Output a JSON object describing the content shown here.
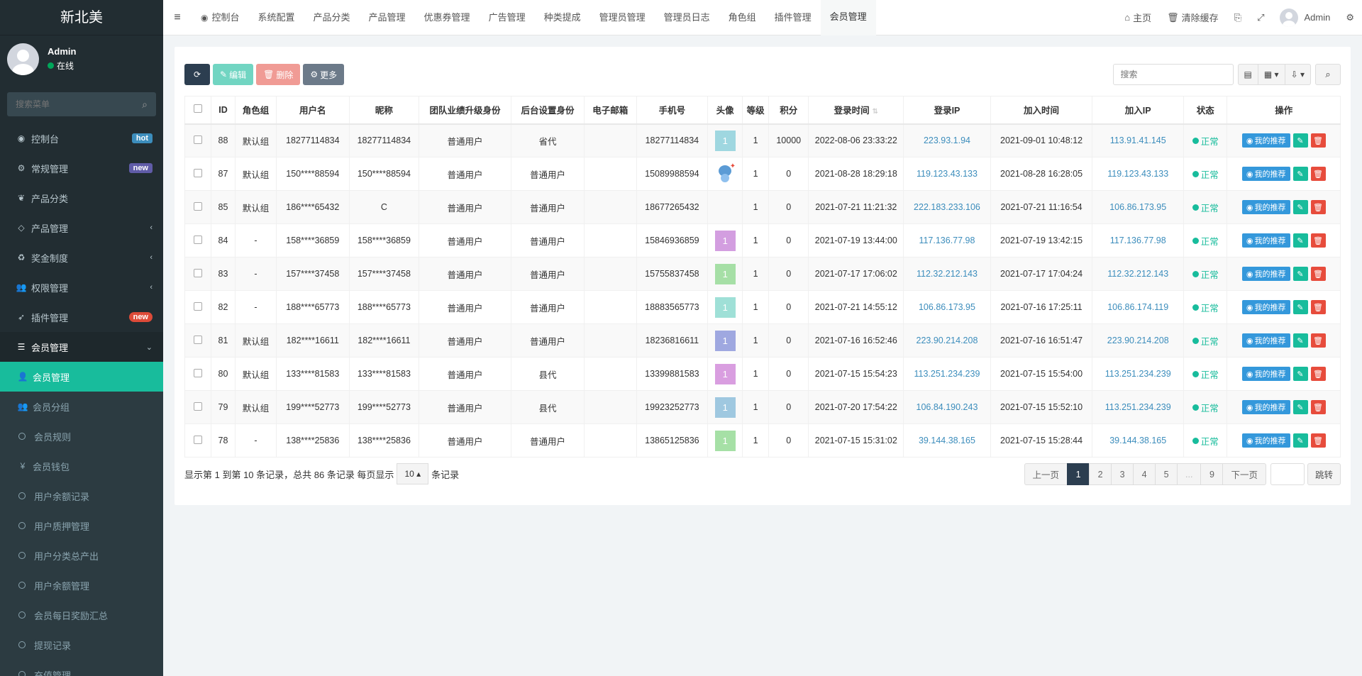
{
  "brand": "新北美",
  "user": {
    "name": "Admin",
    "status": "在线"
  },
  "sidebar": {
    "search_placeholder": "搜索菜单",
    "items": [
      {
        "label": "控制台",
        "icon": "dashboard-icon",
        "glyph": "◉",
        "badge": "hot"
      },
      {
        "label": "常规管理",
        "icon": "cogs-icon",
        "glyph": "⚙",
        "badge": "new"
      },
      {
        "label": "产品分类",
        "icon": "leaf-icon",
        "glyph": "❦"
      },
      {
        "label": "产品管理",
        "icon": "diamond-icon",
        "glyph": "◇"
      },
      {
        "label": "奖金制度",
        "icon": "recycle-icon",
        "glyph": "♻"
      },
      {
        "label": "权限管理",
        "icon": "group-icon",
        "glyph": "👥"
      },
      {
        "label": "插件管理",
        "icon": "rocket-icon",
        "glyph": "➶",
        "badge": "new"
      },
      {
        "label": "会员管理",
        "icon": "list-icon",
        "glyph": "☰"
      },
      {
        "label": "会员管理",
        "icon": "user-icon",
        "glyph": "👤"
      },
      {
        "label": "会员分组",
        "icon": "users-icon",
        "glyph": "👥"
      },
      {
        "label": "会员规则"
      },
      {
        "label": "会员钱包",
        "icon": "yen-icon",
        "glyph": "¥"
      },
      {
        "label": "用户余额记录"
      },
      {
        "label": "用户质押管理"
      },
      {
        "label": "用户分类总产出"
      },
      {
        "label": "用户余额管理"
      },
      {
        "label": "会员每日奖励汇总"
      },
      {
        "label": "提现记录"
      },
      {
        "label": "充值管理"
      }
    ]
  },
  "topnav": {
    "tabs": [
      "控制台",
      "系统配置",
      "产品分类",
      "产品管理",
      "优惠券管理",
      "广告管理",
      "种类提成",
      "管理员管理",
      "管理员日志",
      "角色组",
      "插件管理",
      "会员管理"
    ],
    "home": "主页",
    "clear_cache": "清除缓存",
    "admin": "Admin"
  },
  "toolbar": {
    "edit": "编辑",
    "delete": "删除",
    "more": "更多",
    "search_placeholder": "搜索"
  },
  "table": {
    "headers": [
      "ID",
      "角色组",
      "用户名",
      "昵称",
      "团队业绩升级身份",
      "后台设置身份",
      "电子邮箱",
      "手机号",
      "头像",
      "等级",
      "积分",
      "登录时间",
      "登录IP",
      "加入时间",
      "加入IP",
      "状态",
      "操作"
    ],
    "rows": [
      {
        "id": "88",
        "group": "默认组",
        "username": "18277114834",
        "nickname": "18277114834",
        "team": "普通用户",
        "backend": "省代",
        "email": "",
        "mobile": "18277114834",
        "avatar": "1",
        "avatar_color": "#9fd7e0",
        "level": "1",
        "score": "10000",
        "logintime": "2022-08-06 23:33:22",
        "loginip": "223.93.1.94",
        "jointime": "2021-09-01 10:48:12",
        "joinip": "113.91.41.145",
        "status": "正常"
      },
      {
        "id": "87",
        "group": "默认组",
        "username": "150****88594",
        "nickname": "150****88594",
        "team": "普通用户",
        "backend": "普通用户",
        "email": "",
        "mobile": "15089988594",
        "avatar": "",
        "avatar_color": "mascot",
        "level": "1",
        "score": "0",
        "logintime": "2021-08-28 18:29:18",
        "loginip": "119.123.43.133",
        "jointime": "2021-08-28 16:28:05",
        "joinip": "119.123.43.133",
        "status": "正常"
      },
      {
        "id": "85",
        "group": "默认组",
        "username": "186****65432",
        "nickname": "C",
        "team": "普通用户",
        "backend": "普通用户",
        "email": "",
        "mobile": "18677265432",
        "avatar": "",
        "avatar_color": "none",
        "level": "1",
        "score": "0",
        "logintime": "2021-07-21 11:21:32",
        "loginip": "222.183.233.106",
        "jointime": "2021-07-21 11:16:54",
        "joinip": "106.86.173.95",
        "status": "正常"
      },
      {
        "id": "84",
        "group": "-",
        "username": "158****36859",
        "nickname": "158****36859",
        "team": "普通用户",
        "backend": "普通用户",
        "email": "",
        "mobile": "15846936859",
        "avatar": "1",
        "avatar_color": "#d39ee0",
        "level": "1",
        "score": "0",
        "logintime": "2021-07-19 13:44:00",
        "loginip": "117.136.77.98",
        "jointime": "2021-07-19 13:42:15",
        "joinip": "117.136.77.98",
        "status": "正常"
      },
      {
        "id": "83",
        "group": "-",
        "username": "157****37458",
        "nickname": "157****37458",
        "team": "普通用户",
        "backend": "普通用户",
        "email": "",
        "mobile": "15755837458",
        "avatar": "1",
        "avatar_color": "#a6dfa6",
        "level": "1",
        "score": "0",
        "logintime": "2021-07-17 17:06:02",
        "loginip": "112.32.212.143",
        "jointime": "2021-07-17 17:04:24",
        "joinip": "112.32.212.143",
        "status": "正常"
      },
      {
        "id": "82",
        "group": "-",
        "username": "188****65773",
        "nickname": "188****65773",
        "team": "普通用户",
        "backend": "普通用户",
        "email": "",
        "mobile": "18883565773",
        "avatar": "1",
        "avatar_color": "#9fe0d7",
        "level": "1",
        "score": "0",
        "logintime": "2021-07-21 14:55:12",
        "loginip": "106.86.173.95",
        "jointime": "2021-07-16 17:25:11",
        "joinip": "106.86.174.119",
        "status": "正常"
      },
      {
        "id": "81",
        "group": "默认组",
        "username": "182****16611",
        "nickname": "182****16611",
        "team": "普通用户",
        "backend": "普通用户",
        "email": "",
        "mobile": "18236816611",
        "avatar": "1",
        "avatar_color": "#9fa8e0",
        "level": "1",
        "score": "0",
        "logintime": "2021-07-16 16:52:46",
        "loginip": "223.90.214.208",
        "jointime": "2021-07-16 16:51:47",
        "joinip": "223.90.214.208",
        "status": "正常"
      },
      {
        "id": "80",
        "group": "默认组",
        "username": "133****81583",
        "nickname": "133****81583",
        "team": "普通用户",
        "backend": "县代",
        "email": "",
        "mobile": "13399881583",
        "avatar": "1",
        "avatar_color": "#d99ee0",
        "level": "1",
        "score": "0",
        "logintime": "2021-07-15 15:54:23",
        "loginip": "113.251.234.239",
        "jointime": "2021-07-15 15:54:00",
        "joinip": "113.251.234.239",
        "status": "正常"
      },
      {
        "id": "79",
        "group": "默认组",
        "username": "199****52773",
        "nickname": "199****52773",
        "team": "普通用户",
        "backend": "县代",
        "email": "",
        "mobile": "19923252773",
        "avatar": "1",
        "avatar_color": "#9fc8e0",
        "level": "1",
        "score": "0",
        "logintime": "2021-07-20 17:54:22",
        "loginip": "106.84.190.243",
        "jointime": "2021-07-15 15:52:10",
        "joinip": "113.251.234.239",
        "status": "正常"
      },
      {
        "id": "78",
        "group": "-",
        "username": "138****25836",
        "nickname": "138****25836",
        "team": "普通用户",
        "backend": "普通用户",
        "email": "",
        "mobile": "13865125836",
        "avatar": "1",
        "avatar_color": "#a6e0a6",
        "level": "1",
        "score": "0",
        "logintime": "2021-07-15 15:31:02",
        "loginip": "39.144.38.165",
        "jointime": "2021-07-15 15:28:44",
        "joinip": "39.144.38.165",
        "status": "正常"
      }
    ],
    "op_recommend": "我的推荐"
  },
  "footer": {
    "summary": "显示第 1 到第 10 条记录，总共 86 条记录 每页显示",
    "page_size": "10",
    "suffix": "条记录"
  },
  "pager": {
    "prev": "上一页",
    "pages": [
      "1",
      "2",
      "3",
      "4",
      "5",
      "...",
      "9"
    ],
    "next": "下一页",
    "jump": "跳转"
  },
  "colors": {
    "sidebar_bg": "#222d32",
    "accent": "#18bc9c",
    "primary_dark": "#2c3e50",
    "link": "#3c8dbc",
    "danger": "#e74c3c"
  }
}
